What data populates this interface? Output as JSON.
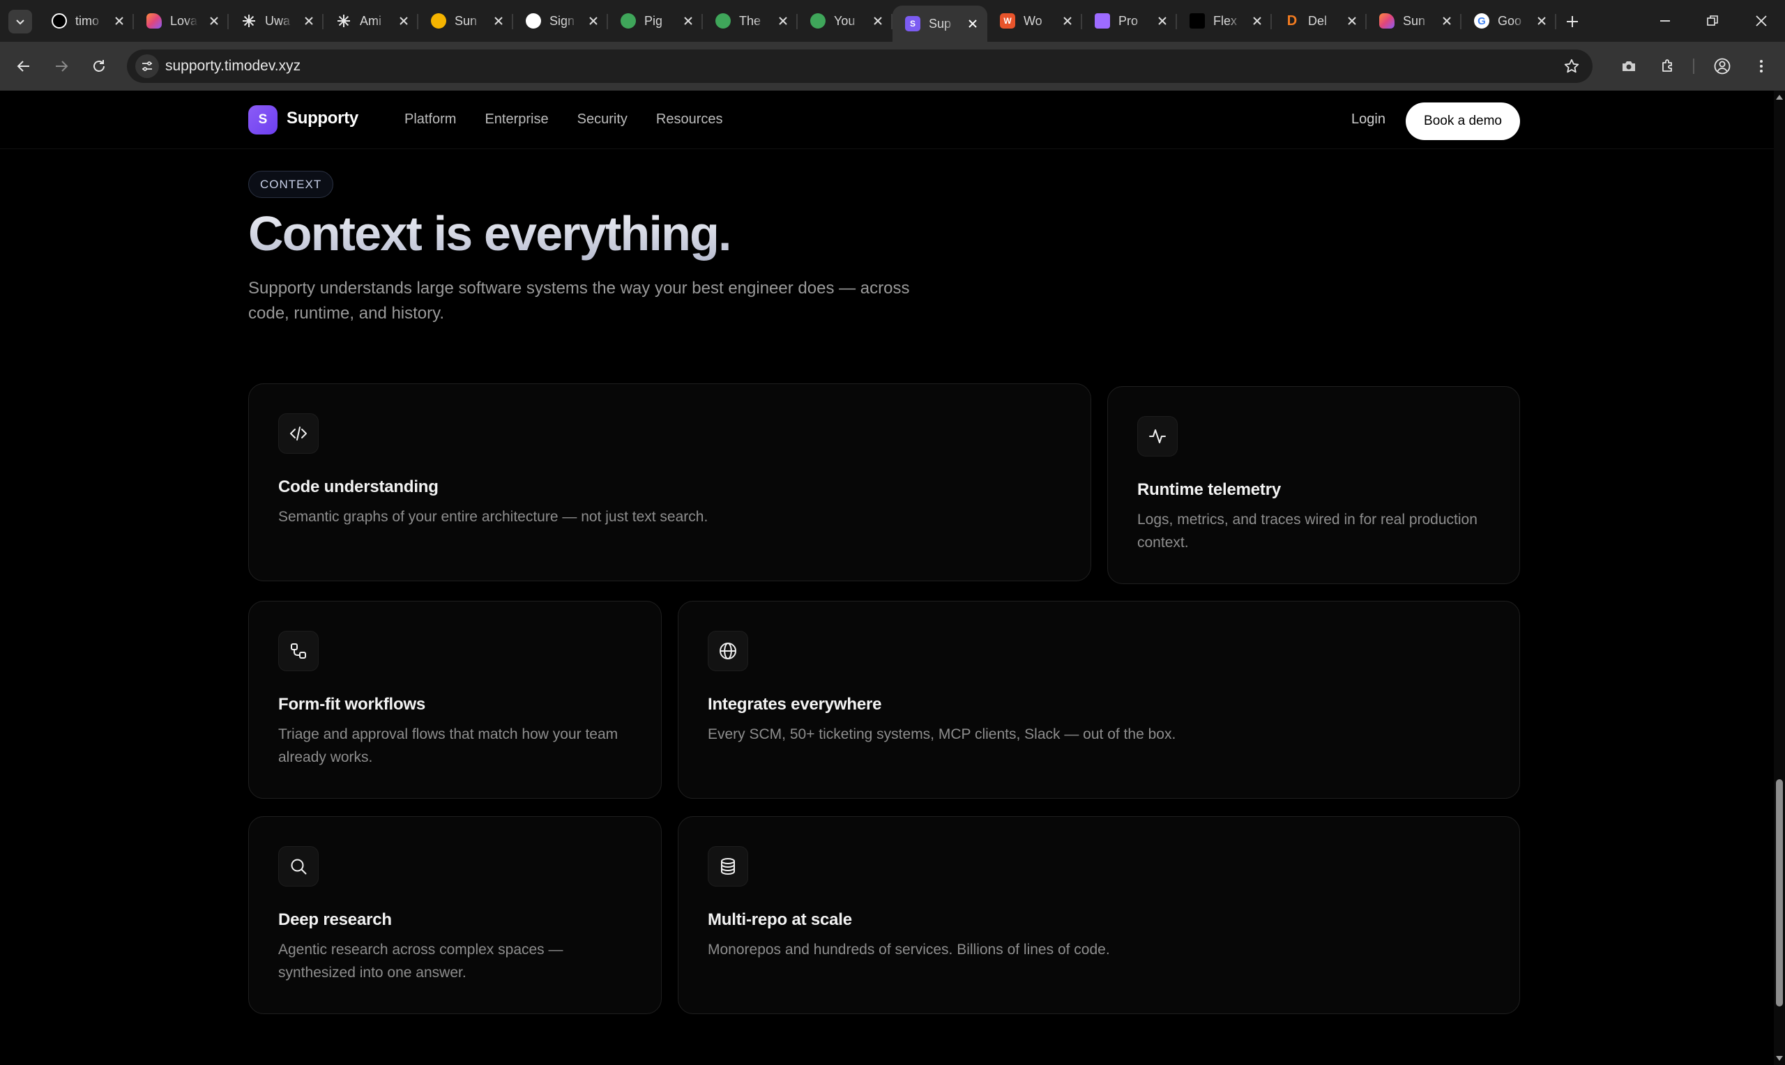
{
  "browser": {
    "tabs": [
      {
        "label": "timo",
        "fav_color": "#ffffff",
        "fav_text": "",
        "fav_bg": "#000000"
      },
      {
        "label": "Lovable",
        "fav_color": "#ff6a3d",
        "fav_text": "",
        "fav_bg": "#e0467c"
      },
      {
        "label": "Uwa",
        "fav_color": "#e8e8e8",
        "fav_text": "",
        "fav_bg": "transparent"
      },
      {
        "label": "Ami",
        "fav_color": "#e8e8e8",
        "fav_text": "",
        "fav_bg": "transparent"
      },
      {
        "label": "Sun",
        "fav_color": "#f5b400",
        "fav_text": "",
        "fav_bg": "#f5b400"
      },
      {
        "label": "Sign",
        "fav_color": "#ffffff",
        "fav_text": "",
        "fav_bg": "#ffffff"
      },
      {
        "label": "Pig",
        "fav_color": "#5fbf6e",
        "fav_text": "",
        "fav_bg": "#3fa65a"
      },
      {
        "label": "The",
        "fav_color": "#5fbf6e",
        "fav_text": "",
        "fav_bg": "#3fa65a"
      },
      {
        "label": "You",
        "fav_color": "#5fbf6e",
        "fav_text": "",
        "fav_bg": "#3fa65a"
      },
      {
        "label": "Sup",
        "fav_color": "#7c5cf2",
        "fav_text": "S",
        "fav_bg": "#7c5cf2",
        "active": true
      },
      {
        "label": "Wo",
        "fav_color": "#e8542b",
        "fav_text": "W",
        "fav_bg": "#e8542b"
      },
      {
        "label": "Pro",
        "fav_color": "#9d6bff",
        "fav_text": "",
        "fav_bg": "#9d6bff"
      },
      {
        "label": "Flex",
        "fav_color": "#000000",
        "fav_text": "",
        "fav_bg": "#000000"
      },
      {
        "label": "Del",
        "fav_color": "#f47c20",
        "fav_text": "D",
        "fav_bg": "transparent"
      },
      {
        "label": "Sun",
        "fav_color": "#e0467c",
        "fav_text": "",
        "fav_bg": "#e0467c"
      },
      {
        "label": "Goo",
        "fav_color": "#4285f4",
        "fav_text": "G",
        "fav_bg": "#ffffff"
      }
    ],
    "url": "supporty.timodev.xyz"
  },
  "site": {
    "logo_letter": "S",
    "brand": "Supporty",
    "nav": [
      "Platform",
      "Enterprise",
      "Security",
      "Resources"
    ],
    "login": "Login",
    "cta": "Book a demo"
  },
  "hero": {
    "badge": "CONTEXT",
    "headline": "Context is everything.",
    "subtitle": "Supporty understands large software systems the way your best engineer does — across code, runtime, and history."
  },
  "features": [
    {
      "icon": "code-icon",
      "title": "Code understanding",
      "desc": "Semantic graphs of your entire architecture — not just text search."
    },
    {
      "icon": "activity-icon",
      "title": "Runtime telemetry",
      "desc": "Logs, metrics, and traces wired in for real production context."
    },
    {
      "icon": "workflow-icon",
      "title": "Form-fit workflows",
      "desc": "Triage and approval flows that match how your team already works."
    },
    {
      "icon": "globe-icon",
      "title": "Integrates everywhere",
      "desc": "Every SCM, 50+ ticketing systems, MCP clients, Slack — out of the box."
    },
    {
      "icon": "search-icon",
      "title": "Deep research",
      "desc": "Agentic research across complex spaces — synthesized into one answer."
    },
    {
      "icon": "database-icon",
      "title": "Multi-repo at scale",
      "desc": "Monorepos and hundreds of services. Billions of lines of code."
    }
  ],
  "colors": {
    "accent": "#7c5cf2",
    "background": "#000000",
    "card": "#070707",
    "muted_text": "#8e8e8e"
  }
}
